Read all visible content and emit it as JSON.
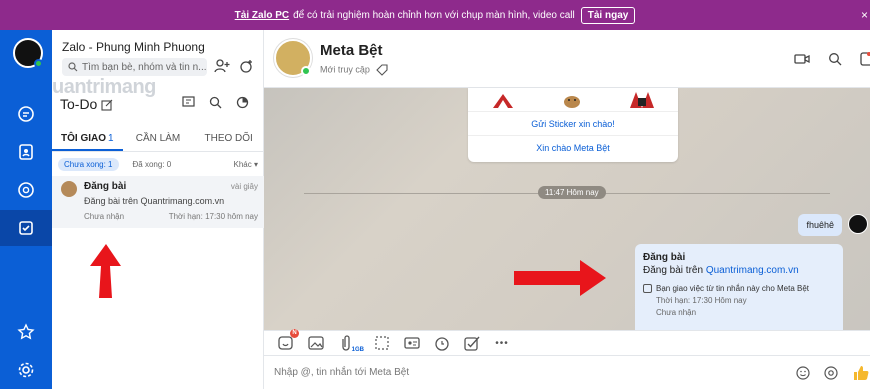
{
  "banner": {
    "link_text": "Tải Zalo PC",
    "message": "để có trải nghiệm hoàn chỉnh hơn với chụp màn hình, video call",
    "button": "Tải ngay",
    "close": "×"
  },
  "rail": {
    "items": [
      "chat",
      "contacts",
      "mentions",
      "todo",
      "favorites",
      "settings"
    ]
  },
  "panel": {
    "user_name": "Zalo - Phung Minh Phuong",
    "search_placeholder": "Tìm bạn bè, nhóm và tin n...",
    "todo_title": "To-Do",
    "watermark": "uantrimang",
    "tabs": [
      {
        "label": "Tôi giao",
        "count": "1"
      },
      {
        "label": "Cần làm",
        "count": ""
      },
      {
        "label": "Theo dõi",
        "count": ""
      }
    ],
    "filters": {
      "done_active": "Chưa xong: 1",
      "done": "Đã xong: 0",
      "more": "Khác"
    },
    "task": {
      "title": "Đăng bài",
      "time": "vài giây",
      "desc": "Đăng bài trên Quantrimang.com.vn",
      "status": "Chưa nhận",
      "deadline": "Thời hạn: 17:30 hôm nay"
    }
  },
  "chat": {
    "name": "Meta Bệt",
    "status": "Mới truy cập",
    "sticker_link1": "Gửi Sticker xin chào!",
    "sticker_link2": "Xin chào Meta Bệt",
    "time_divider": "11:47 Hôm nay",
    "my_message": "fhuêhê",
    "card": {
      "title": "Đăng bài",
      "desc_prefix": "Đăng bài trên ",
      "desc_link": "Quantrimang.com.vn",
      "checkbox_text": "Bạn giao việc từ tin nhắn này cho Meta Bệt",
      "deadline": "Thời hạn: 17:30 Hôm nay",
      "status": "Chưa nhận"
    },
    "toolbar": {
      "badge": "N",
      "file_limit": "1GB",
      "more": "•••"
    },
    "input_placeholder": "Nhập @, tin nhắn tới Meta Bệt"
  },
  "colors": {
    "brand": "#0b5fd6",
    "banner": "#8e2a8c",
    "arrow": "#e8151b"
  }
}
